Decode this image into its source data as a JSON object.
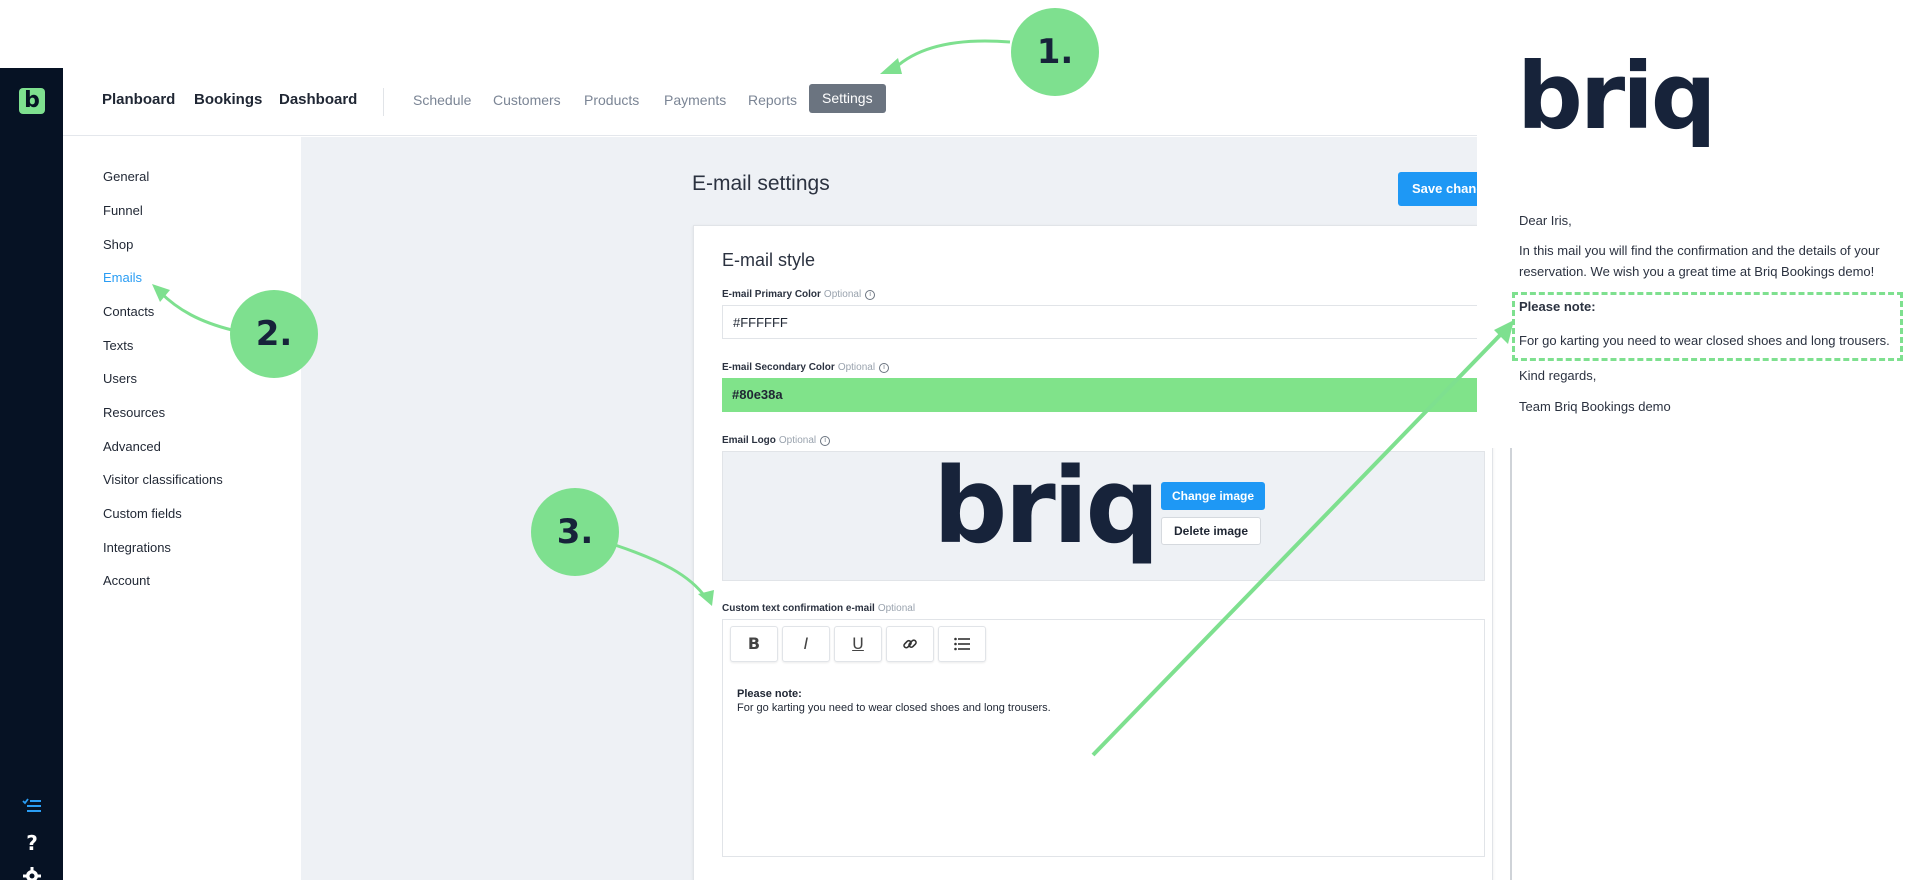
{
  "nav": {
    "main_items": [
      "Planboard",
      "Bookings",
      "Dashboard"
    ],
    "sub_items": [
      "Schedule",
      "Customers",
      "Products",
      "Payments",
      "Reports"
    ],
    "active": "Settings"
  },
  "rail": {
    "logo_letter": "b",
    "icons": [
      "list-check-icon",
      "help-icon",
      "gear-icon"
    ],
    "help_glyph": "?"
  },
  "settings_menu": {
    "items": [
      "General",
      "Funnel",
      "Shop",
      "Emails",
      "Contacts",
      "Texts",
      "Users",
      "Resources",
      "Advanced",
      "Visitor classifications",
      "Custom fields",
      "Integrations",
      "Account"
    ],
    "active": "Emails"
  },
  "page": {
    "title": "E-mail settings",
    "save_label": "Save changes"
  },
  "email_style": {
    "title": "E-mail style",
    "optional_tag": "Optional",
    "primary_label": "E-mail Primary Color",
    "primary_value": "#FFFFFF",
    "secondary_label": "E-mail Secondary Color",
    "secondary_value": "#80e38a",
    "logo_label": "Email Logo",
    "logo_text": "briq",
    "change_image": "Change image",
    "delete_image": "Delete image",
    "custom_text_label": "Custom text confirmation e-mail",
    "editor_bold": "Please note:",
    "editor_text": "For go karting you need to wear closed shoes and long trousers."
  },
  "toolbar": {
    "buttons": [
      "B",
      "I",
      "U",
      "link",
      "list"
    ]
  },
  "preview": {
    "logo_text": "briq",
    "greeting": "Dear Iris,",
    "intro": "In this mail you will find the confirmation and the details of your reservation. We wish you a great time at Briq Bookings demo!",
    "note_title": "Please note:",
    "note_text": "For go karting you need to wear closed shoes and long trousers.",
    "closing": "Kind regards,",
    "signature": "Team Briq Bookings demo"
  },
  "annotations": [
    "1.",
    "2.",
    "3."
  ],
  "colors": {
    "accent_green": "#7ee08f",
    "primary_blue": "#1e98f5",
    "rail_dark": "#061224",
    "brand_navy": "#17233a"
  }
}
